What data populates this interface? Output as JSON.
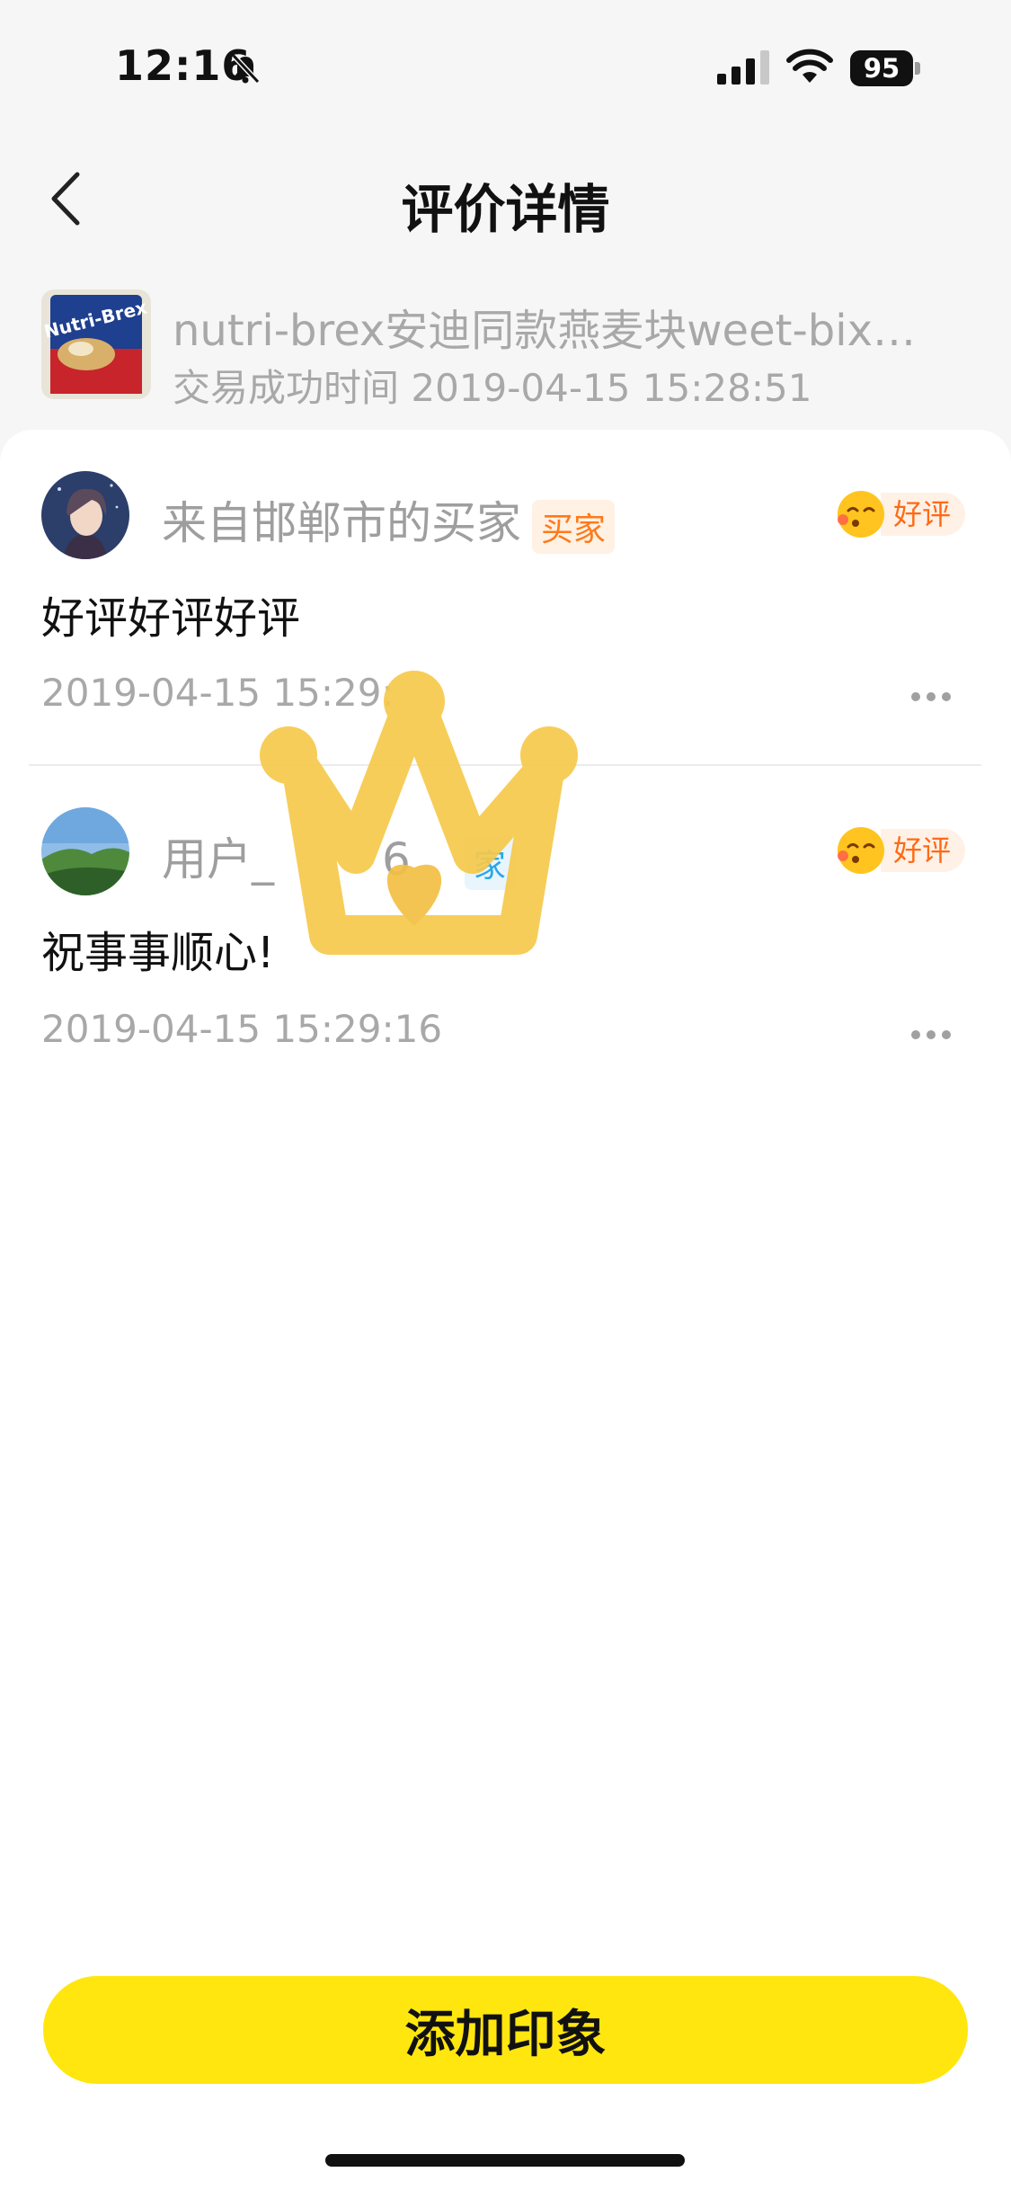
{
  "status_bar": {
    "time": "12:16",
    "battery": "95"
  },
  "nav": {
    "title": "评价详情"
  },
  "product": {
    "name": "nutri-brex安迪同款燕麦块weet-bix…",
    "trade_time": "交易成功时间 2019-04-15 15:28:51",
    "thumb_text": "Nutri-Brex"
  },
  "reviews": [
    {
      "user": "来自邯郸市的买家",
      "role": "买家",
      "rating": "好评",
      "content": "好评好评好评",
      "time": "2019-04-15 15:29:",
      "avatar": "avatar-anime-boy"
    },
    {
      "user": "用户_",
      "user_tail": "6",
      "role": "家",
      "rating": "好评",
      "content": "祝事事顺心!",
      "time": "2019-04-15 15:29:16",
      "avatar": "avatar-mountain-landscape"
    }
  ],
  "footer": {
    "add_button": "添加印象"
  },
  "colors": {
    "accent_yellow": "#ffe60f",
    "buyer_tag": "#ff7a1a",
    "seller_tag": "#2aa7e8",
    "rating_text": "#ff6a14"
  },
  "icons": [
    "back-arrow-icon",
    "bell-slash-icon",
    "signal-icon",
    "wifi-icon",
    "battery-icon",
    "smile-face-icon",
    "more-dots-icon",
    "crown-icon"
  ]
}
